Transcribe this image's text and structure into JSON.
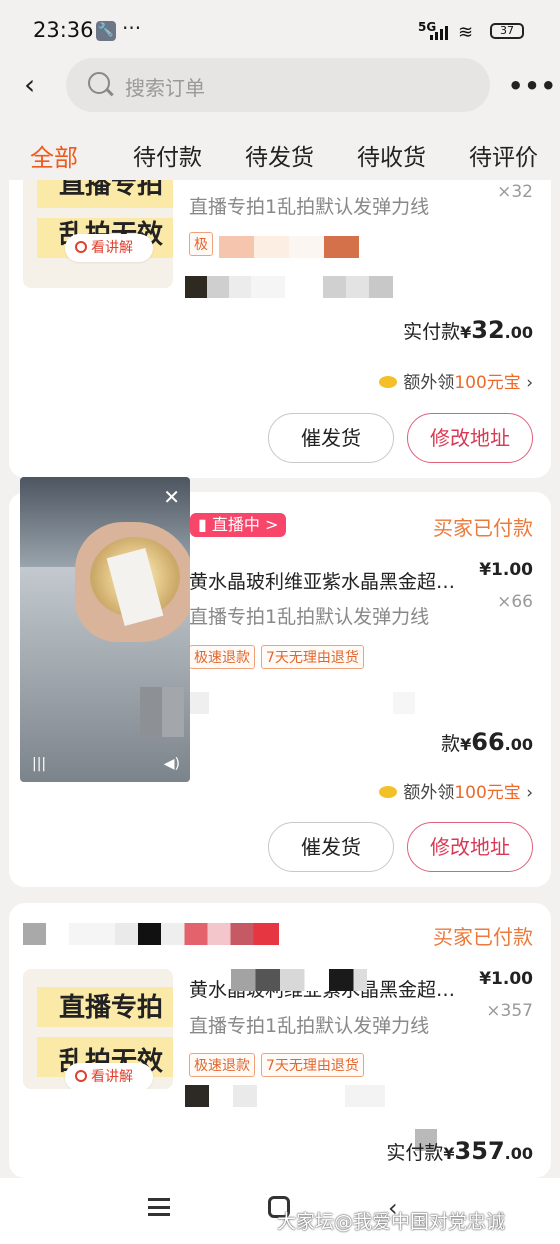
{
  "status_bar": {
    "time": "23:36",
    "dots": "···",
    "network": "5G",
    "battery": "37"
  },
  "search": {
    "placeholder": "搜索订单",
    "more": "•••"
  },
  "tabs": [
    "全部",
    "待付款",
    "待发货",
    "待收货",
    "待评价"
  ],
  "accent": "#ef5a1e",
  "orders": [
    {
      "thumb_text_1": "直播专拍",
      "thumb_text_2": "乱拍无效",
      "watch_label": "看讲解",
      "subtitle": "直播专拍1乱拍默认发弹力线",
      "qty": "×32",
      "tag_partial": "极",
      "total_label": "实付款",
      "total_currency": "¥",
      "total_int": "32",
      "total_dec": ".00",
      "bonus_prefix": "额外领",
      "bonus_value": "100元宝",
      "btn_1": "催发货",
      "btn_2": "修改地址"
    },
    {
      "live_label": "直播中 >",
      "status": "买家已付款",
      "title": "黄水晶玻利维亚紫水晶黑金超…",
      "price": "¥1.00",
      "subtitle": "直播专拍1乱拍默认发弹力线",
      "qty": "×66",
      "tag_1": "极速退款",
      "tag_2": "7天无理由退货",
      "total_label": "款",
      "total_currency": "¥",
      "total_int": "66",
      "total_dec": ".00",
      "bonus_prefix": "额外领",
      "bonus_value": "100元宝",
      "btn_1": "催发货",
      "btn_2": "修改地址"
    },
    {
      "status": "买家已付款",
      "thumb_text_1": "直播专拍",
      "thumb_text_2": "乱拍无效",
      "watch_label": "看讲解",
      "title": "黄水晶玻利维亚紫水晶黑金超…",
      "price": "¥1.00",
      "subtitle": "直播专拍1乱拍默认发弹力线",
      "qty": "×357",
      "tag_1": "极速退款",
      "tag_2": "7天无理由退货",
      "total_label": "实付款",
      "total_currency": "¥",
      "total_int": "357",
      "total_dec": ".00"
    }
  ],
  "video": {
    "close": "✕"
  },
  "watermark": "大家坛@我爱中国对党忠诚"
}
